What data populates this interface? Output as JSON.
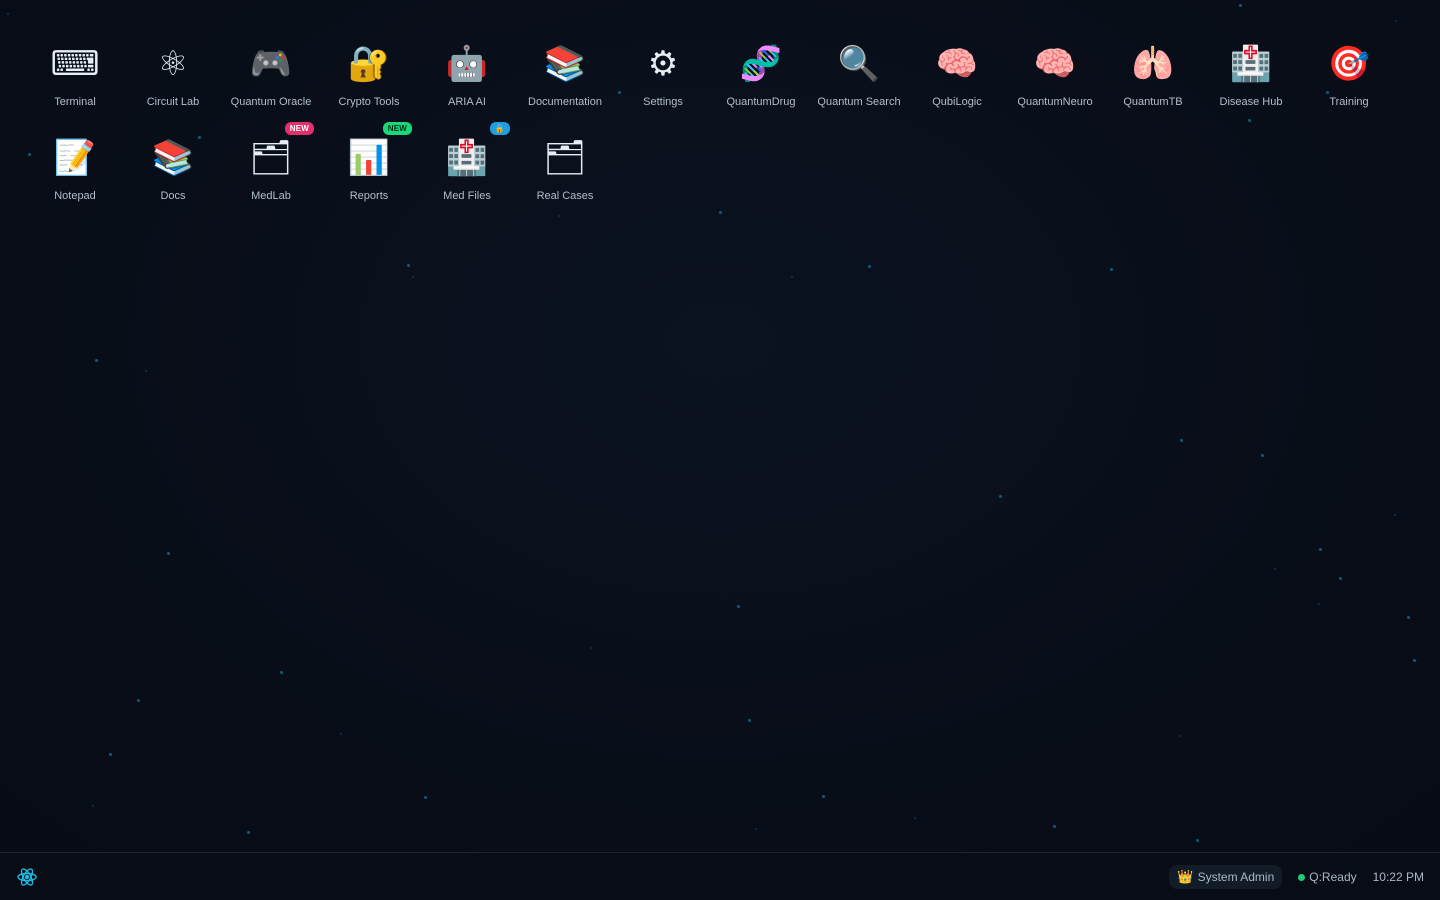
{
  "desktop": {
    "apps": [
      {
        "label": "Terminal",
        "icon": "⌨",
        "icon_name": "keyboard-icon",
        "badge": ""
      },
      {
        "label": "Circuit Lab",
        "icon": "⚛",
        "icon_name": "atom-icon",
        "badge": ""
      },
      {
        "label": "Quantum Oracle",
        "icon": "🎮",
        "icon_name": "gamepad-icon",
        "badge": ""
      },
      {
        "label": "Crypto Tools",
        "icon": "🔐",
        "icon_name": "lock-key-icon",
        "badge": ""
      },
      {
        "label": "ARIA AI",
        "icon": "🤖",
        "icon_name": "robot-icon",
        "badge": ""
      },
      {
        "label": "Documentation",
        "icon": "📚",
        "icon_name": "books-icon",
        "badge": ""
      },
      {
        "label": "Settings",
        "icon": "⚙",
        "icon_name": "gear-icon",
        "badge": ""
      },
      {
        "label": "QuantumDrug",
        "icon": "🧬",
        "icon_name": "dna-icon",
        "badge": ""
      },
      {
        "label": "Quantum Search",
        "icon": "🔍",
        "icon_name": "magnifier-icon",
        "badge": ""
      },
      {
        "label": "QubiLogic",
        "icon": "🧠",
        "icon_name": "brain-icon",
        "badge": ""
      },
      {
        "label": "QuantumNeuro",
        "icon": "🧠",
        "icon_name": "brain-icon",
        "badge": ""
      },
      {
        "label": "QuantumTB",
        "icon": "🫁",
        "icon_name": "lungs-icon",
        "badge": ""
      },
      {
        "label": "Disease Hub",
        "icon": "🏥",
        "icon_name": "hospital-icon",
        "badge": ""
      },
      {
        "label": "Training",
        "icon": "🎯",
        "icon_name": "target-icon",
        "badge": ""
      },
      {
        "label": "Notepad",
        "icon": "📝",
        "icon_name": "memo-icon",
        "badge": ""
      },
      {
        "label": "Docs",
        "icon": "📚",
        "icon_name": "books-icon",
        "badge": ""
      },
      {
        "label": "MedLab",
        "icon": "🗂",
        "icon_name": "folder-icon",
        "badge": "NEW",
        "badge_style": "new-red"
      },
      {
        "label": "Reports",
        "icon": "📊",
        "icon_name": "bar-chart-icon",
        "badge": "NEW",
        "badge_style": "new-green"
      },
      {
        "label": "Med Files",
        "icon": "🏥",
        "icon_name": "hospital-icon",
        "badge": "🔒",
        "badge_style": "dot-blue"
      },
      {
        "label": "Real Cases",
        "icon": "🗂",
        "icon_name": "folder-icon",
        "badge": ""
      }
    ]
  },
  "taskbar": {
    "start_icon": "atom-logo-icon",
    "user_crown": "👑",
    "user_label": "System Admin",
    "status_label": "Q:Ready",
    "clock": "10:22 PM"
  },
  "colors": {
    "background": "#0a0f1a",
    "accent": "#1eb8e0",
    "status_ready": "#1ec97c",
    "badge_red": "#e0316b",
    "badge_green": "#16d97a",
    "badge_blue": "#1e9de0"
  }
}
